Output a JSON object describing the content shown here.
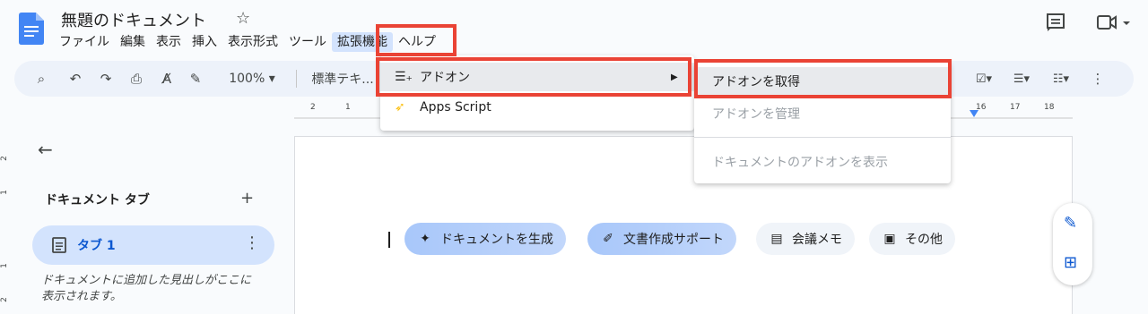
{
  "document": {
    "title": "無題のドキュメント"
  },
  "menubar": {
    "items": [
      "ファイル",
      "編集",
      "表示",
      "挿入",
      "表示形式",
      "ツール",
      "拡張機能",
      "ヘルプ"
    ]
  },
  "toolbar": {
    "zoom": "100%",
    "style": "標準テキ..."
  },
  "ruler": {
    "numbers": [
      "2",
      "1",
      "16",
      "17",
      "18"
    ]
  },
  "vruler": {
    "numbers": [
      "2",
      "1",
      "1",
      "2"
    ]
  },
  "sidebar": {
    "title": "ドキュメント タブ",
    "tab_label": "タブ 1",
    "hint": "ドキュメントに追加した見出しがここに表示されます。"
  },
  "chips": [
    {
      "label": "ドキュメントを生成"
    },
    {
      "label": "文書作成サポート"
    },
    {
      "label": "会議メモ"
    },
    {
      "label": "その他"
    }
  ],
  "extensions_menu": {
    "addons": "アドオン",
    "apps_script": "Apps Script"
  },
  "addons_submenu": {
    "get": "アドオンを取得",
    "manage": "アドオンを管理",
    "show": "ドキュメントのアドオンを表示"
  },
  "colors": {
    "accent": "#0b57d0",
    "highlight": "#ea4335",
    "chip": "#a8c7fa"
  }
}
